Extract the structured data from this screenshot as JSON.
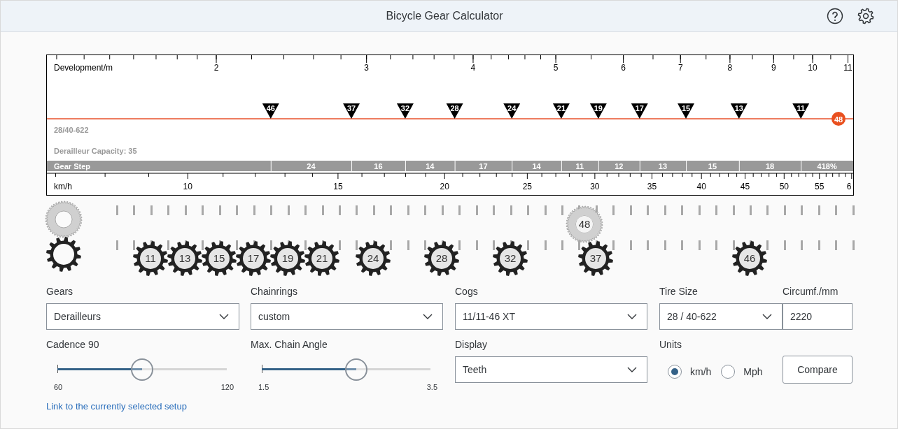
{
  "header": {
    "title": "Bicycle Gear Calculator"
  },
  "chart": {
    "development_label": "Development/m",
    "development_ticks": [
      "2",
      "3",
      "4",
      "5",
      "6",
      "7",
      "8",
      "9",
      "10",
      "11"
    ],
    "speed_label": "km/h",
    "speed_ticks": [
      "10",
      "15",
      "20",
      "25",
      "30",
      "35",
      "40",
      "45",
      "50",
      "55",
      "6"
    ],
    "tire_note": "28/40-622",
    "capacity_note": "Derailleur Capacity: 35",
    "gear_step_label": "Gear Step",
    "gear_steps": [
      "24",
      "16",
      "14",
      "17",
      "14",
      "11",
      "12",
      "13",
      "15",
      "18",
      "418%"
    ],
    "chainring_badge": "48",
    "cog_markers": [
      "46",
      "37",
      "32",
      "28",
      "24",
      "21",
      "19",
      "17",
      "15",
      "13",
      "11"
    ]
  },
  "lanes": {
    "chainrings": [
      "48"
    ],
    "cogs": [
      "11",
      "13",
      "15",
      "17",
      "19",
      "21",
      "24",
      "28",
      "32",
      "37",
      "46"
    ]
  },
  "fields": [
    {
      "label": "Gears",
      "value": "Derailleurs",
      "kind": "select"
    },
    {
      "label": "Chainrings",
      "value": "custom",
      "kind": "select"
    },
    {
      "label": "Cogs",
      "value": "11/11-46 XT",
      "kind": "select"
    },
    {
      "label": "Tire Size",
      "value": "28 / 40-622",
      "kind": "select"
    },
    {
      "label": "Circumf./mm",
      "value": "2220",
      "kind": "input"
    }
  ],
  "sliders": [
    {
      "label": "Cadence 90",
      "min": "60",
      "max": "120",
      "level": 0.5
    },
    {
      "label": "Max. Chain Angle",
      "min": "1.5",
      "max": "3.5",
      "level": 0.56
    }
  ],
  "display": {
    "label": "Display",
    "value": "Teeth"
  },
  "units": {
    "label": "Units",
    "options": [
      {
        "label": "km/h",
        "selected": true
      },
      {
        "label": "Mph",
        "selected": false
      }
    ]
  },
  "compare_button": "Compare",
  "link": "Link to the currently selected setup"
}
